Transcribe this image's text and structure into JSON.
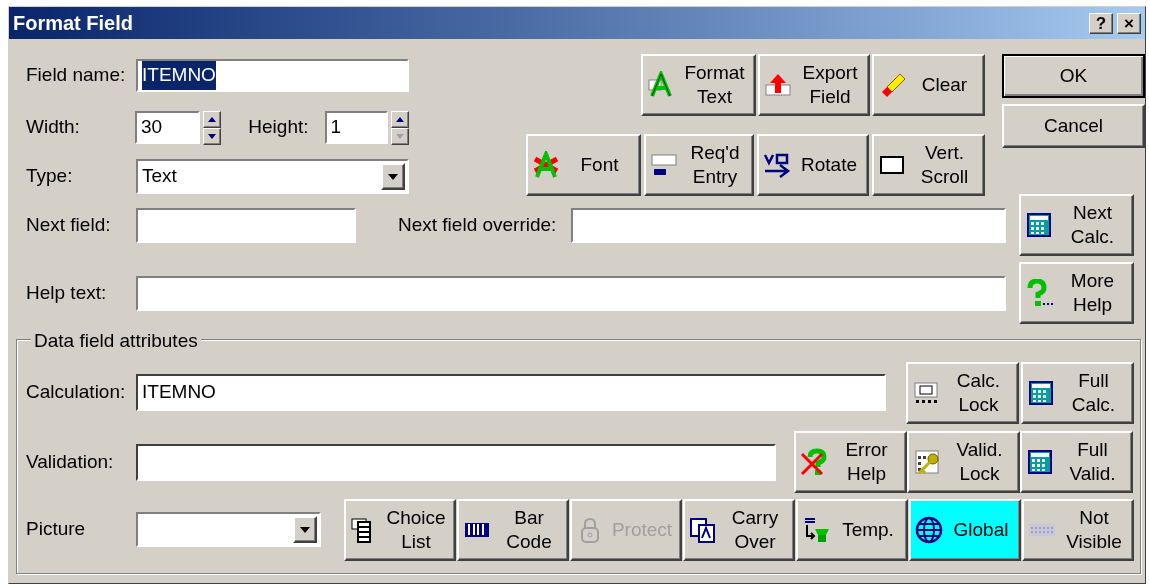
{
  "window": {
    "title": "Format Field",
    "controls": [
      "?",
      "×"
    ]
  },
  "field_name": {
    "label": "Field name:",
    "value": "ITEMNO",
    "text_selected": true
  },
  "width": {
    "label": "Width:",
    "value": "30",
    "decrement_disabled": false
  },
  "height": {
    "label": "Height:",
    "value": "1",
    "decrement_disabled": true
  },
  "type": {
    "label": "Type:",
    "value": "Text"
  },
  "format_buttons": [
    {
      "lines": [
        "Format",
        "Text"
      ]
    },
    {
      "lines": [
        "Export",
        "Field"
      ]
    },
    {
      "lines": [
        "Clear"
      ]
    }
  ],
  "style_buttons": [
    {
      "lines": [
        "Font"
      ]
    },
    {
      "lines": [
        "Req'd",
        "Entry"
      ]
    },
    {
      "lines": [
        "Rotate"
      ]
    },
    {
      "lines": [
        "Vert.",
        "Scroll"
      ]
    }
  ],
  "dialog_buttons": [
    {
      "label": "OK",
      "default": true
    },
    {
      "label": "Cancel",
      "default": false
    }
  ],
  "next_field": {
    "label": "Next field:"
  },
  "next_field_override": {
    "label": "Next field override:"
  },
  "next_calc_button": {
    "lines": [
      "Next",
      "Calc."
    ]
  },
  "help_text": {
    "label": "Help text:"
  },
  "more_help_button": {
    "lines": [
      "More",
      "Help"
    ]
  },
  "data_field_attributes": {
    "title": "Data field attributes",
    "calculation": {
      "label": "Calculation:",
      "value": "ITEMNO"
    },
    "calc_buttons": [
      {
        "lines": [
          "Calc.",
          "Lock"
        ]
      },
      {
        "lines": [
          "Full",
          "Calc."
        ]
      }
    ],
    "validation": {
      "label": "Validation:"
    },
    "validation_buttons": [
      {
        "lines": [
          "Error",
          "Help"
        ]
      },
      {
        "lines": [
          "Valid.",
          "Lock"
        ]
      },
      {
        "lines": [
          "Full",
          "Valid."
        ]
      }
    ],
    "picture": {
      "label": "Picture"
    },
    "attribute_buttons": [
      {
        "lines": [
          "Choice",
          "List"
        ],
        "disabled": false,
        "selected": false
      },
      {
        "lines": [
          "Bar",
          "Code"
        ],
        "disabled": false,
        "selected": false
      },
      {
        "lines": [
          "Protect"
        ],
        "disabled": true,
        "selected": false
      },
      {
        "lines": [
          "Carry",
          "Over"
        ],
        "disabled": false,
        "selected": false
      },
      {
        "lines": [
          "Temp."
        ],
        "disabled": false,
        "selected": false
      },
      {
        "lines": [
          "Global"
        ],
        "disabled": false,
        "selected": true
      },
      {
        "lines": [
          "Not",
          "Visible"
        ],
        "disabled": false,
        "selected": false
      }
    ]
  }
}
